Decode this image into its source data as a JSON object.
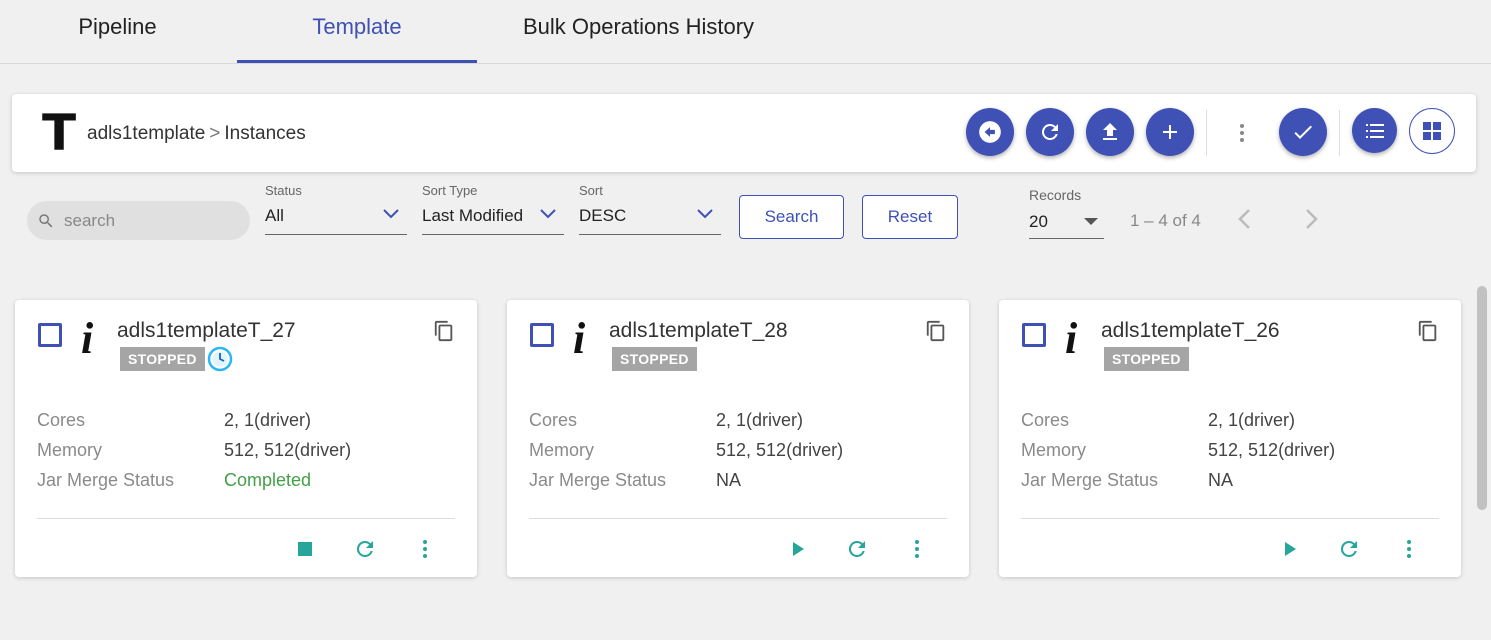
{
  "tabs": [
    {
      "label": "Pipeline",
      "active": false
    },
    {
      "label": "Template",
      "active": true
    },
    {
      "label": "Bulk Operations History",
      "active": false
    }
  ],
  "header": {
    "logo_letter": "T",
    "breadcrumb_root": "adls1template",
    "breadcrumb_sep": ">",
    "breadcrumb_leaf": "Instances",
    "actions": [
      "back-icon",
      "refresh-icon",
      "upload-icon",
      "add-icon",
      "more-vert-icon",
      "check-icon",
      "list-view-icon",
      "grid-view-icon"
    ]
  },
  "filters": {
    "search_placeholder": "search",
    "status": {
      "label": "Status",
      "value": "All"
    },
    "sort_type": {
      "label": "Sort Type",
      "value": "Last Modified"
    },
    "sort": {
      "label": "Sort",
      "value": "DESC"
    },
    "search_button": "Search",
    "reset_button": "Reset"
  },
  "pagination": {
    "records_label": "Records",
    "records_value": "20",
    "range": "1 – 4 of 4"
  },
  "labels": {
    "cores": "Cores",
    "memory": "Memory",
    "jar_merge": "Jar Merge Status"
  },
  "cards": [
    {
      "name": "adls1templateT_27",
      "status": "STOPPED",
      "scheduled": true,
      "cores": "2, 1(driver)",
      "memory": "512, 512(driver)",
      "jar_merge": "Completed",
      "primary_action": "stop"
    },
    {
      "name": "adls1templateT_28",
      "status": "STOPPED",
      "scheduled": false,
      "cores": "2, 1(driver)",
      "memory": "512, 512(driver)",
      "jar_merge": "NA",
      "primary_action": "play"
    },
    {
      "name": "adls1templateT_26",
      "status": "STOPPED",
      "scheduled": false,
      "cores": "2, 1(driver)",
      "memory": "512, 512(driver)",
      "jar_merge": "NA",
      "primary_action": "play"
    }
  ],
  "colors": {
    "primary": "#3f51b5",
    "teal": "#26a69a",
    "completed": "#43a047",
    "status_badge": "#a5a5a5"
  }
}
